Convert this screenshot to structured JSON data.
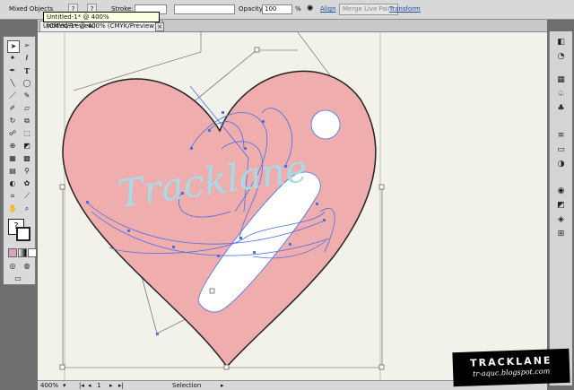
{
  "control_bar": {
    "selection_type": "Mixed Objects",
    "stroke_label": "Stroke:",
    "opacity_label": "Opacity:",
    "opacity_value": "100",
    "opacity_unit": "%",
    "align_label": "Align",
    "merge_live_paint_label": "Merge Live Paint",
    "transform_label": "Transform"
  },
  "tooltip": {
    "text": "Untitled-1* @ 400% (CMYK/Preview)"
  },
  "document": {
    "tab_title": "Untitled-1* @ 400% (CMYK/Preview)",
    "close_glyph": "×"
  },
  "artwork": {
    "script_text": "Tracklane",
    "heart_fill": "#efadad",
    "path_color": "#4a6fe6",
    "text_color": "#a8dbe6"
  },
  "status_bar": {
    "zoom": "400%",
    "page_number": "1",
    "tool_name": "Selection"
  },
  "watermark": {
    "title": "TRACKLANE",
    "subtitle": "tr-aquc.blogspot.com"
  },
  "tools": [
    "selection-tool",
    "direct-selection-tool",
    "magic-wand-tool",
    "lasso-tool",
    "pen-tool",
    "type-tool",
    "line-tool",
    "ellipse-tool",
    "paintbrush-tool",
    "pencil-tool",
    "blob-brush-tool",
    "eraser-tool",
    "rotate-tool",
    "scale-tool",
    "warp-tool",
    "free-transform-tool",
    "shape-builder-tool",
    "live-paint-tool",
    "perspective-tool",
    "mesh-tool",
    "gradient-tool",
    "eyedropper-tool",
    "blend-tool",
    "symbol-sprayer-tool",
    "graph-tool",
    "artboard-tool",
    "slice-tool",
    "hand-tool",
    "zoom-tool"
  ],
  "right_panel_icons": [
    "color-panel-icon",
    "color-guide-icon",
    "swatches-icon",
    "brushes-icon",
    "symbols-icon",
    "stroke-icon",
    "gradient-icon",
    "transparency-icon",
    "appearance-icon",
    "graphic-styles-icon",
    "layers-icon",
    "artboards-icon"
  ]
}
